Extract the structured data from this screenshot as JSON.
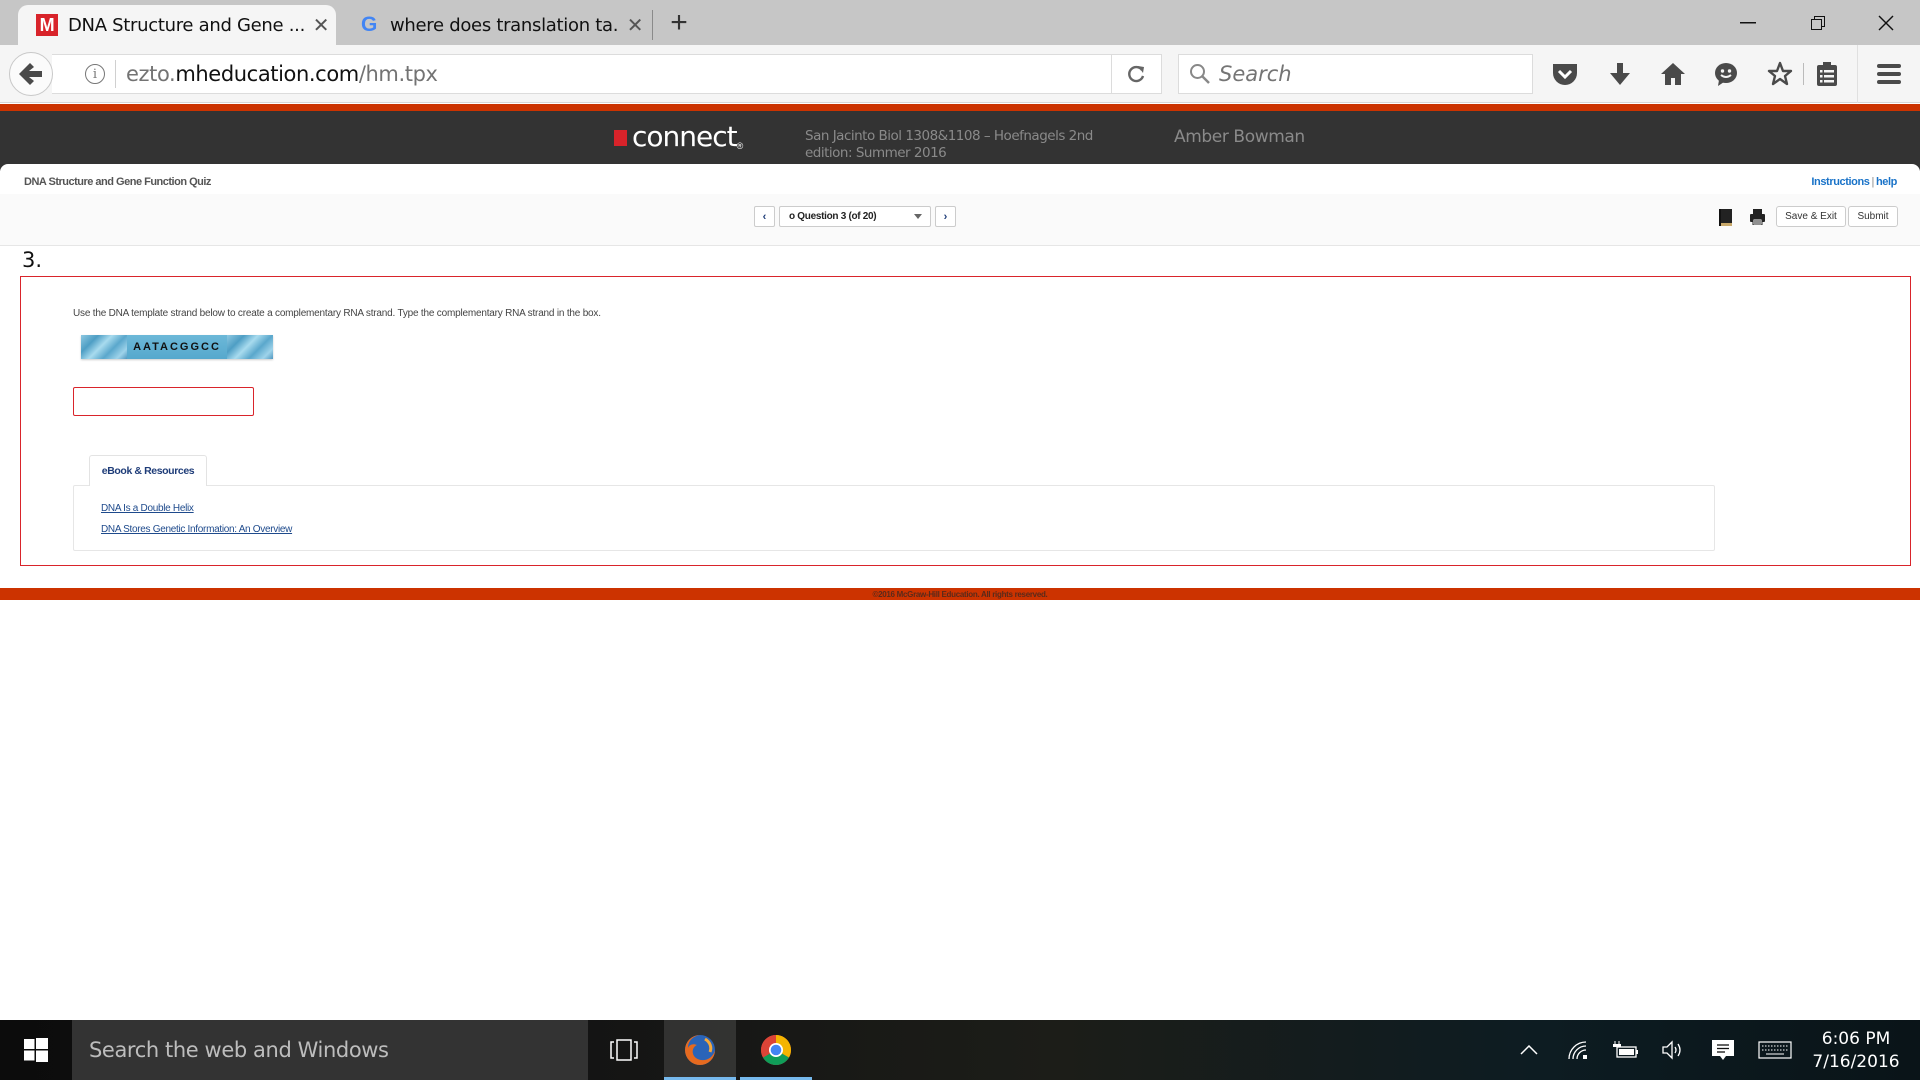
{
  "browser": {
    "tabs": [
      {
        "title": "DNA Structure and Gene ...",
        "favicon": "mcgraw-hill-icon",
        "active": true
      },
      {
        "title": "where does translation ta...",
        "favicon": "google-icon",
        "active": false
      }
    ],
    "new_tab_symbol": "+",
    "close_symbol": "✕",
    "window_controls": {
      "minimize": "—",
      "restore": "❐",
      "close": "✕"
    },
    "url": {
      "prefix": "ezto.",
      "domain": "mheducation.com",
      "path": "/hm.tpx"
    },
    "search_placeholder": "Search",
    "toolbar_icons": [
      "pocket-icon",
      "download-icon",
      "home-icon",
      "hello-chat-icon",
      "bookmark-star-icon",
      "reading-list-icon",
      "menu-icon"
    ]
  },
  "connect": {
    "logo_text": "connect",
    "logo_mark": "®",
    "course_name": "San Jacinto Biol 1308&1108 – Hoefnagels 2nd edition: Summer 2016",
    "user_name": "Amber Bowman"
  },
  "quiz": {
    "title": "DNA Structure and Gene Function Quiz",
    "links": {
      "instructions": "Instructions",
      "separator": "|",
      "help": "help"
    },
    "question_selector": "o Question 3 (of 20)",
    "prev_symbol": "‹",
    "next_symbol": "›",
    "buttons": {
      "save_exit": "Save & Exit",
      "submit": "Submit"
    },
    "question_number": "3.",
    "prompt": "Use the DNA template strand below to create a complementary RNA strand. Type the complementary RNA strand in the box.",
    "dna_sequence": "AATACGGCC",
    "answer_value": "",
    "resources_tab": "eBook & Resources",
    "resources": [
      {
        "label": "DNA Is a Double Helix"
      },
      {
        "label": "DNA Stores Genetic Information: An Overview"
      }
    ],
    "footer": "©2016 McGraw-Hill Education. All rights reserved."
  },
  "colors": {
    "brand_orange": "#cc3300",
    "header_dark": "#333333",
    "error_red": "#d9242b",
    "link_blue": "#1e4a8c"
  },
  "taskbar": {
    "search_placeholder": "Search the web and Windows",
    "apps": [
      "firefox-icon",
      "chrome-icon"
    ],
    "time": "6:06 PM",
    "date": "7/16/2016"
  }
}
